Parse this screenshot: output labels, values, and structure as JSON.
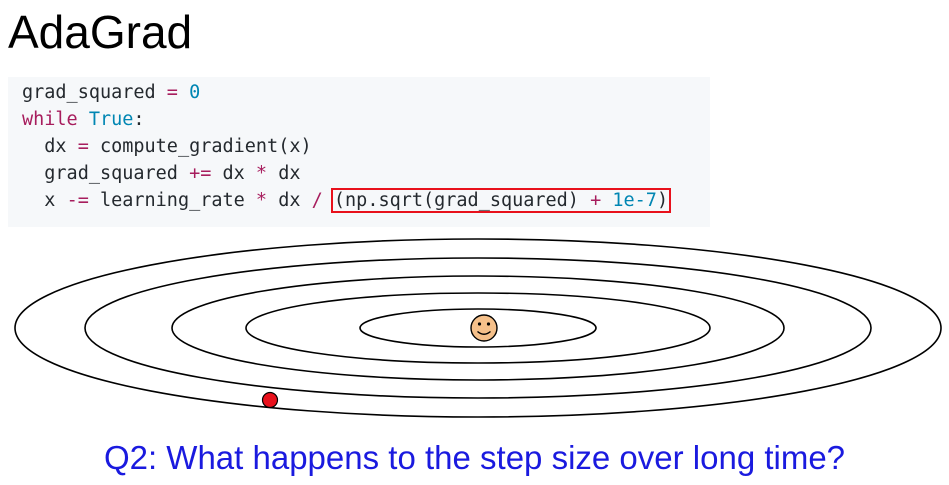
{
  "title": "AdaGrad",
  "code": {
    "line1": {
      "var": "grad_squared",
      "op": "=",
      "num": "0"
    },
    "line2": {
      "kw": "while",
      "builtin": "True",
      "colon": ":"
    },
    "line3": {
      "lhs": "dx",
      "op": "=",
      "rhs": "compute_gradient(x)"
    },
    "line4": {
      "lhs": "grad_squared",
      "op": "+=",
      "a": "dx",
      "op2": "*",
      "b": "dx"
    },
    "line5": {
      "lhs": "x",
      "op": "-=",
      "a": "learning_rate",
      "op2": "*",
      "b": "dx",
      "op3": "/",
      "boxed_pre": "(np.sqrt(grad_squared)",
      "boxed_op": "+",
      "boxed_num": "1e-7",
      "boxed_post": ")"
    }
  },
  "diagram": {
    "contour_count": 5,
    "minimum_marker": "smiley-face-icon",
    "current_point_marker": "red-dot-icon",
    "colors": {
      "contour": "#000000",
      "smiley_fill": "#f5c08a",
      "red_dot": "#e8111c",
      "highlight": "#e8111c"
    }
  },
  "question": "Q2: What happens to the step size over long time?"
}
